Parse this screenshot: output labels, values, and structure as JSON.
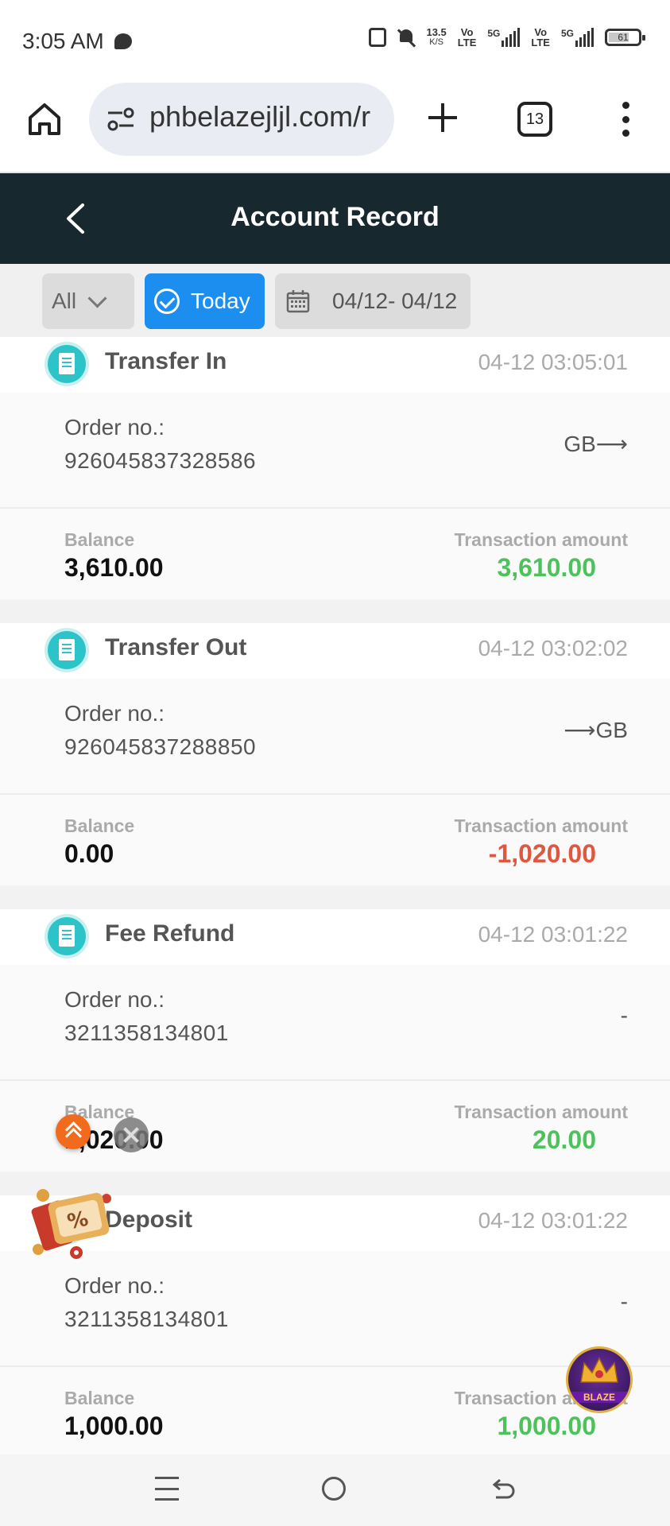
{
  "status_bar": {
    "time": "3:05 AM",
    "speed_value": "13.5",
    "speed_unit": "K/S",
    "sim1_top": "Vo",
    "sim1_bottom": "LTE",
    "net1": "5G",
    "sim2_top": "Vo",
    "sim2_bottom": "LTE",
    "net2": "5G",
    "battery": "61",
    "icons": [
      "chat-icon",
      "nfc-icon",
      "mute-icon",
      "signal-icon",
      "battery-icon"
    ]
  },
  "browser": {
    "url": "phbelazejljl.com/r",
    "tab_count": "13",
    "icons": [
      "home-icon",
      "site-settings-icon",
      "plus-icon",
      "tabs-icon",
      "more-icon"
    ]
  },
  "header": {
    "title": "Account Record",
    "back_icon": "chevron-left-icon"
  },
  "filters": {
    "type_select": "All",
    "today_label": "Today",
    "date_range": "04/12- 04/12"
  },
  "labels": {
    "order_no": "Order no.:",
    "balance": "Balance",
    "transaction_amount": "Transaction amount"
  },
  "records": [
    {
      "type": "Transfer In",
      "time": "04-12 03:05:01",
      "order_no": "926045837328586",
      "direction": "GB⟶",
      "balance": "3,610.00",
      "amount": "3,610.00",
      "amount_sign": "positive"
    },
    {
      "type": "Transfer Out",
      "time": "04-12 03:02:02",
      "order_no": "926045837288850",
      "direction": "⟶GB",
      "balance": "0.00",
      "amount": "-1,020.00",
      "amount_sign": "negative"
    },
    {
      "type": "Fee Refund",
      "time": "04-12 03:01:22",
      "order_no": "3211358134801",
      "direction": "-",
      "balance": "1,020.00",
      "amount": "20.00",
      "amount_sign": "positive"
    },
    {
      "type": "Deposit",
      "time": "04-12 03:01:22",
      "order_no": "3211358134801",
      "direction": "-",
      "balance": "1,000.00",
      "amount": "1,000.00",
      "amount_sign": "positive"
    }
  ],
  "floating": {
    "blaze_label": "BLAZE"
  },
  "colors": {
    "header_bg": "#17292f",
    "accent_blue": "#1b8ef0",
    "positive": "#4cc35a",
    "negative": "#e0563f",
    "record_icon": "#2cc4c8"
  }
}
